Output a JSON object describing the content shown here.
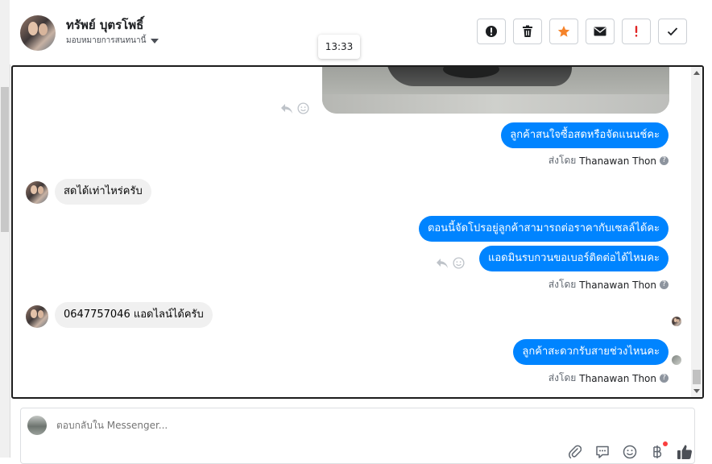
{
  "header": {
    "name": "ทรัพย์ บุตรโพธิ์",
    "subtitle": "มอบหมายการสนทนานี้",
    "actions": [
      "report-icon",
      "trash-icon",
      "star-icon",
      "mail-icon",
      "exclamation-icon",
      "check-icon"
    ]
  },
  "tooltip": {
    "time": "13:33"
  },
  "conversation": {
    "sent_by_label": "ส่งโดย",
    "sent_by_name": "Thanawan Thon",
    "messages": [
      {
        "dir": "out",
        "text": "ลูกค้าสนใจซื้อสดหรือจัดแนนช์คะ"
      },
      {
        "dir": "in",
        "text": "สดได้เท่าไหร่ครับ"
      },
      {
        "dir": "out",
        "text": "ตอนนี้จัดโปรอยู่ลูกค้าสามารถต่อราคากับเซลล์ได้คะ"
      },
      {
        "dir": "out",
        "text": "แอดมินรบกวนขอเบอร์ติดต่อได้ไหมคะ"
      },
      {
        "dir": "in",
        "text": "0647757046 แอดไลน์ได้ครับ"
      },
      {
        "dir": "out",
        "text": "ลูกค้าสะดวกรับสายช่วงไหนคะ"
      }
    ]
  },
  "composer": {
    "placeholder": "ตอบกลับใน Messenger..."
  },
  "colors": {
    "accent": "#0084ff",
    "star": "#f5832a",
    "danger": "#e02424",
    "incoming": "#f0f0f0"
  }
}
